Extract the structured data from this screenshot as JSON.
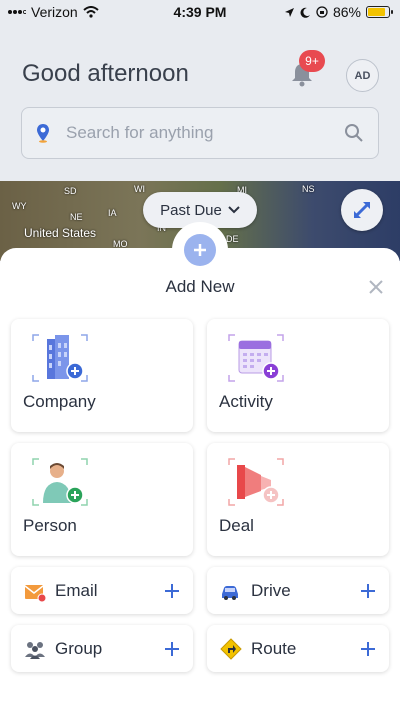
{
  "status_bar": {
    "carrier": "Verizon",
    "time": "4:39 PM",
    "battery": "86%",
    "battery_level": 0.86
  },
  "header": {
    "greeting": "Good afternoon",
    "notification_count": "9+",
    "avatar_initials": "AD"
  },
  "search": {
    "placeholder": "Search for anything"
  },
  "map": {
    "labels": [
      "WY",
      "SD",
      "WI",
      "MI",
      "NE",
      "IA",
      "NS",
      "United States",
      "MO",
      "IN",
      "DE"
    ],
    "filter_label": "Past Due"
  },
  "sheet": {
    "title": "Add New",
    "cards": {
      "company": "Company",
      "activity": "Activity",
      "person": "Person",
      "deal": "Deal"
    },
    "rows": {
      "email": "Email",
      "drive": "Drive",
      "group": "Group",
      "route": "Route"
    }
  },
  "colors": {
    "accent": "#3c6ad6",
    "badge": "#e84a50",
    "fab": "#9bb3ee"
  }
}
